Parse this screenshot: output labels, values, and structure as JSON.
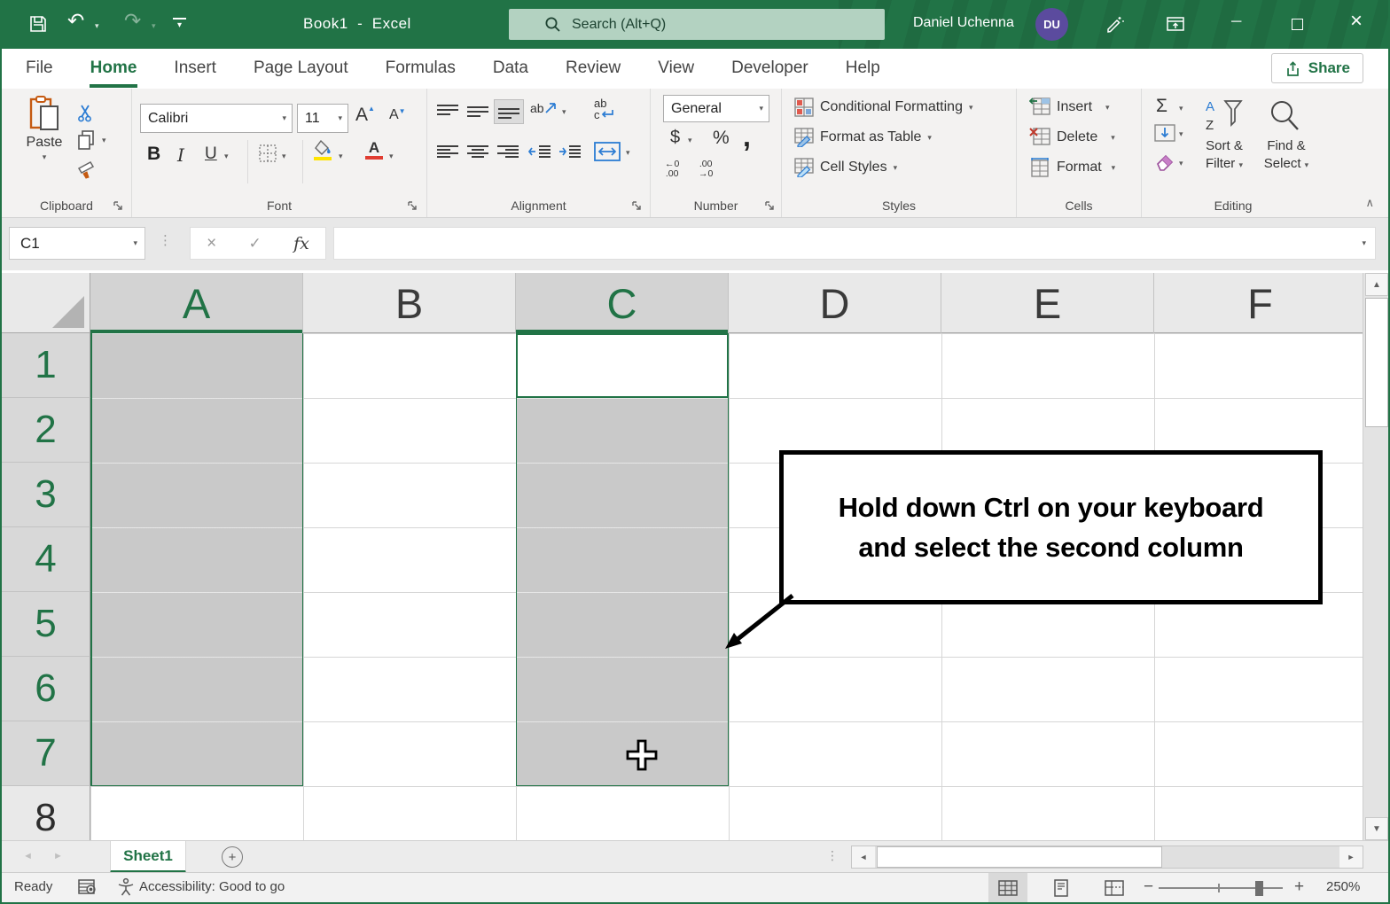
{
  "titlebar": {
    "title": "Book1  -  Excel",
    "search_placeholder": "Search (Alt+Q)",
    "user_name": "Daniel Uchenna",
    "user_initials": "DU"
  },
  "tabs": [
    "File",
    "Home",
    "Insert",
    "Page Layout",
    "Formulas",
    "Data",
    "Review",
    "View",
    "Developer",
    "Help"
  ],
  "share_label": "Share",
  "ribbon": {
    "clipboard": {
      "label": "Clipboard",
      "paste": "Paste"
    },
    "font": {
      "label": "Font",
      "family": "Calibri",
      "size": "11",
      "bold": "B",
      "italic": "I",
      "underline": "U",
      "grow": "A",
      "shrink": "A",
      "color_a": "A"
    },
    "alignment": {
      "label": "Alignment",
      "ori": "ab",
      "wrap_ab": "ab",
      "wrap_c": "c"
    },
    "number": {
      "label": "Number",
      "format": "General",
      "currency": "$",
      "percent": "%",
      "comma": ",",
      "inc_top": "←0",
      "inc_bot": ".00",
      "dec_top": ".00",
      "dec_bot": "→0"
    },
    "styles": {
      "label": "Styles",
      "conditional": "Conditional Formatting",
      "format_table": "Format as Table",
      "cell_styles": "Cell Styles"
    },
    "cells": {
      "label": "Cells",
      "insert": "Insert",
      "delete": "Delete",
      "format": "Format"
    },
    "editing": {
      "label": "Editing",
      "autosum": "Σ",
      "sort1": "Sort &",
      "sort2": "Filter",
      "find1": "Find &",
      "find2": "Select"
    }
  },
  "formula_bar": {
    "name_box": "C1",
    "fx": "fx",
    "value": ""
  },
  "grid": {
    "columns": [
      "A",
      "B",
      "C",
      "D",
      "E",
      "F"
    ],
    "rows": [
      "1",
      "2",
      "3",
      "4",
      "5",
      "6",
      "7",
      "8"
    ],
    "selected_columns": "A, C",
    "active_cell": "C1"
  },
  "callout": {
    "line1": "Hold down Ctrl on your keyboard",
    "line2": "and select the second column"
  },
  "sheet_bar": {
    "sheet_name": "Sheet1",
    "add": "+"
  },
  "status_bar": {
    "ready": "Ready",
    "accessibility": "Accessibility: Good to go",
    "zoom": "250%"
  },
  "icons": {
    "undo": "↶",
    "redo": "↷",
    "chevron_down": "▾",
    "collapse": "∧",
    "close": "×",
    "minimize": "─",
    "cancel": "×",
    "check": "✓",
    "up": "▲",
    "down": "▼",
    "left": "◄",
    "right": "►",
    "dots": "⋮"
  },
  "colors": {
    "accent": "#217346",
    "titlebar": "#217346",
    "search-bg": "#b3d2c1",
    "avatar-bg": "#5b4b9e",
    "sel-fill": "#c9c9c9",
    "grid-line": "#d6d6d6",
    "ribbon-bg": "#f3f2f1",
    "hdr-sel": "#d3d3d3",
    "hdr-bg": "#e9e9e9"
  }
}
